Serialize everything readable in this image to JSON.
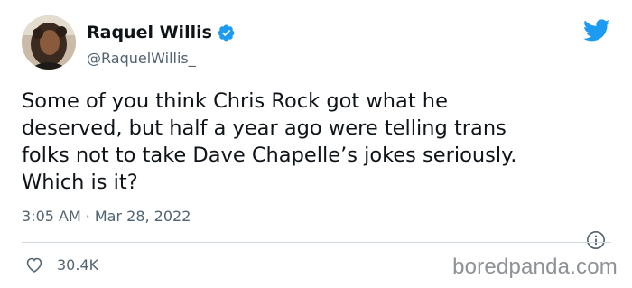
{
  "author": {
    "display_name": "Raquel Willis",
    "handle": "@RaquelWillis_",
    "verified": true
  },
  "tweet": {
    "text": "Some of you think Chris Rock got what he\ndeserved, but half a year ago were telling trans\nfolks not to take Dave Chapelle’s jokes seriously.\nWhich is it?",
    "time": "3:05 AM",
    "separator": "·",
    "date": "Mar 28, 2022"
  },
  "engagement": {
    "likes": "30.4K"
  },
  "watermark": "boredpanda.com",
  "colors": {
    "twitter_blue": "#1d9bf0",
    "secondary_text": "#536471",
    "primary_text": "#0f1419",
    "divider": "#cfd9de"
  },
  "icons": [
    "twitter-bird-icon",
    "verified-badge-icon",
    "info-icon",
    "heart-icon"
  ]
}
